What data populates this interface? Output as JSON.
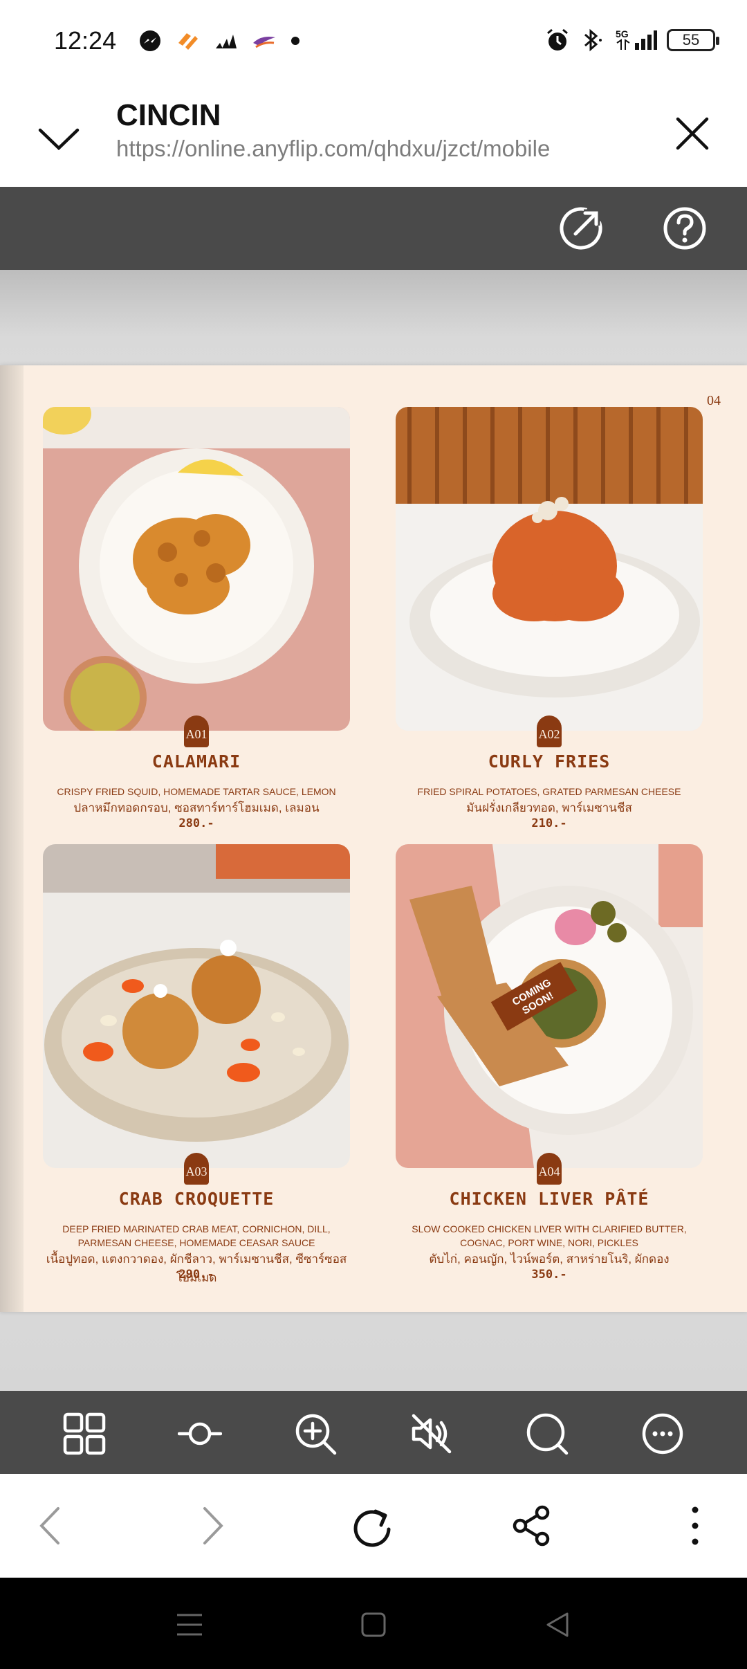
{
  "status_bar": {
    "time": "12:24",
    "battery": "55",
    "network": "5G",
    "left_icons": [
      "messenger-icon",
      "app-icon",
      "adidas-icon",
      "app-icon-purple",
      "dot-icon"
    ],
    "right_icons": [
      "alarm-icon",
      "bluetooth-icon",
      "signal-icon",
      "battery-icon"
    ]
  },
  "header": {
    "title": "CINCIN",
    "url": "https://online.anyflip.com/qhdxu/jzct/mobile"
  },
  "viewer_top_icons": [
    "share-external-icon",
    "help-icon"
  ],
  "page": {
    "page_number": "04",
    "items": [
      {
        "code": "A01",
        "name": "CALAMARI",
        "desc_en": "CRISPY FRIED SQUID, HOMEMADE TARTAR SAUCE, LEMON",
        "desc_th": "ปลาหมึกทอดกรอบ, ซอสทาร์ทาร์โฮมเมด, เลมอน",
        "price": "280.-"
      },
      {
        "code": "A02",
        "name": "CURLY FRIES",
        "desc_en": "FRIED SPIRAL POTATOES, GRATED PARMESAN CHEESE",
        "desc_th": "มันฝรั่งเกลียวทอด, พาร์เมซานชีส",
        "price": "210.-"
      },
      {
        "code": "A03",
        "name": "CRAB CROQUETTE",
        "desc_en": "DEEP FRIED MARINATED CRAB MEAT, CORNICHON, DILL, PARMESAN CHEESE, HOMEMADE CEASAR SAUCE",
        "desc_th": "เนื้อปูทอด, แตงกวาดอง, ผักชีลาว, พาร์เมซานชีส, ซีซาร์ซอสโฮมเมด",
        "price": "290.-"
      },
      {
        "code": "A04",
        "name": "CHICKEN LIVER PÂTÉ",
        "desc_en": "SLOW COOKED CHICKEN LIVER WITH CLARIFIED BUTTER, COGNAC, PORT WINE, NORI, PICKLES",
        "desc_th": "ตับไก่, คอนญัก, ไวน์พอร์ต, สาหร่ายโนริ, ผักดอง",
        "price": "350.-",
        "badge": "COMING SOON!"
      }
    ]
  },
  "viewer_bottom_icons": [
    "thumbnails-icon",
    "autoflip-icon",
    "zoom-in-icon",
    "sound-off-icon",
    "search-icon",
    "more-icon"
  ],
  "browser_nav_icons": [
    "back-icon",
    "forward-icon",
    "reload-icon",
    "share-icon",
    "menu-icon"
  ],
  "system_nav_icons": [
    "recent-apps-icon",
    "home-icon",
    "back-triangle-icon"
  ],
  "colors": {
    "toolbar": "#4a4a4a",
    "page_bg": "#fbeee2",
    "menu_text": "#8a3a12"
  }
}
